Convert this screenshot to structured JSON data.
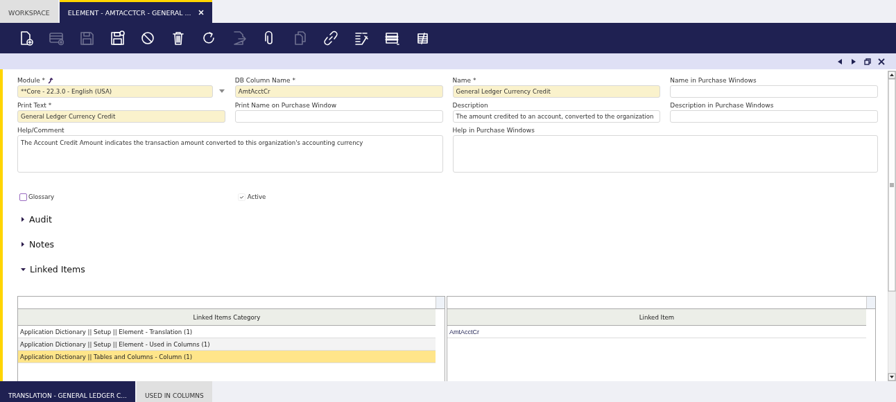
{
  "tabs": [
    {
      "label": "WORKSPACE",
      "selected": false,
      "closable": false
    },
    {
      "label": "ELEMENT - AMTACCTCR - GENERAL ...",
      "selected": true,
      "closable": true
    }
  ],
  "toolbar": [
    {
      "kind": "new",
      "disabled": false
    },
    {
      "kind": "newrow",
      "disabled": true
    },
    {
      "kind": "save",
      "disabled": true
    },
    {
      "kind": "saveclose",
      "disabled": false
    },
    {
      "kind": "undo",
      "disabled": false
    },
    {
      "kind": "delete",
      "disabled": false
    },
    {
      "kind": "refresh",
      "disabled": false
    },
    {
      "kind": "export",
      "disabled": true
    },
    {
      "kind": "attach",
      "disabled": false
    },
    {
      "kind": "clone",
      "disabled": true
    },
    {
      "kind": "link",
      "disabled": false
    },
    {
      "kind": "audit",
      "disabled": false
    },
    {
      "kind": "grid",
      "disabled": false
    },
    {
      "kind": "notes",
      "disabled": false
    }
  ],
  "fields": [
    {
      "label": "Module *",
      "kind": "dropdown",
      "value": "**Core - 22.3.0 - English (USA)",
      "required": true,
      "link": true
    },
    {
      "label": "DB Column Name *",
      "kind": "text",
      "value": "AmtAcctCr",
      "required": true
    },
    {
      "label": "Name *",
      "kind": "text",
      "value": "General Ledger Currency Credit",
      "required": true
    },
    {
      "label": "Name in Purchase Windows",
      "kind": "text",
      "required": false
    },
    {
      "label": "Print Text *",
      "kind": "text",
      "value": "General Ledger Currency Credit",
      "required": true
    },
    {
      "label": "Print Name on Purchase Window",
      "kind": "text",
      "required": false
    },
    {
      "label": "Description",
      "kind": "text",
      "value": "The amount credited to an account, converted to the organization",
      "required": false
    },
    {
      "label": "Description in Purchase Windows",
      "kind": "text",
      "required": false
    },
    {
      "label": "Help/Comment",
      "kind": "textarea",
      "value": "The Account Credit Amount indicates the transaction amount converted to this organization's accounting currency",
      "required": false
    },
    {
      "label": "Help in Purchase Windows",
      "kind": "textarea",
      "required": false
    }
  ],
  "checkboxes": [
    {
      "label": "Glossary",
      "checked": false
    },
    {
      "label": "Active",
      "checked": true
    }
  ],
  "sections": [
    {
      "title": "Audit",
      "expanded": false
    },
    {
      "title": "Notes",
      "expanded": false
    },
    {
      "title": "Linked Items",
      "expanded": true
    }
  ],
  "linked_items": {
    "categories": {
      "column": "Linked Items Category",
      "rows": [
        {
          "text": "Application Dictionary || Setup || Element - Translation (1)",
          "selected": false
        },
        {
          "text": "Application Dictionary || Setup || Element - Used in Columns (1)",
          "selected": false
        },
        {
          "text": "Application Dictionary || Tables and Columns - Column (1)",
          "selected": true
        }
      ]
    },
    "items": {
      "column": "Linked Item",
      "rows": [
        {
          "text": "AmtAcctCr",
          "selected": false
        }
      ]
    }
  },
  "bottom_tabs": [
    {
      "label": "TRANSLATION - GENERAL LEDGER C...",
      "selected": true
    },
    {
      "label": "USED IN COLUMNS",
      "selected": false
    }
  ]
}
